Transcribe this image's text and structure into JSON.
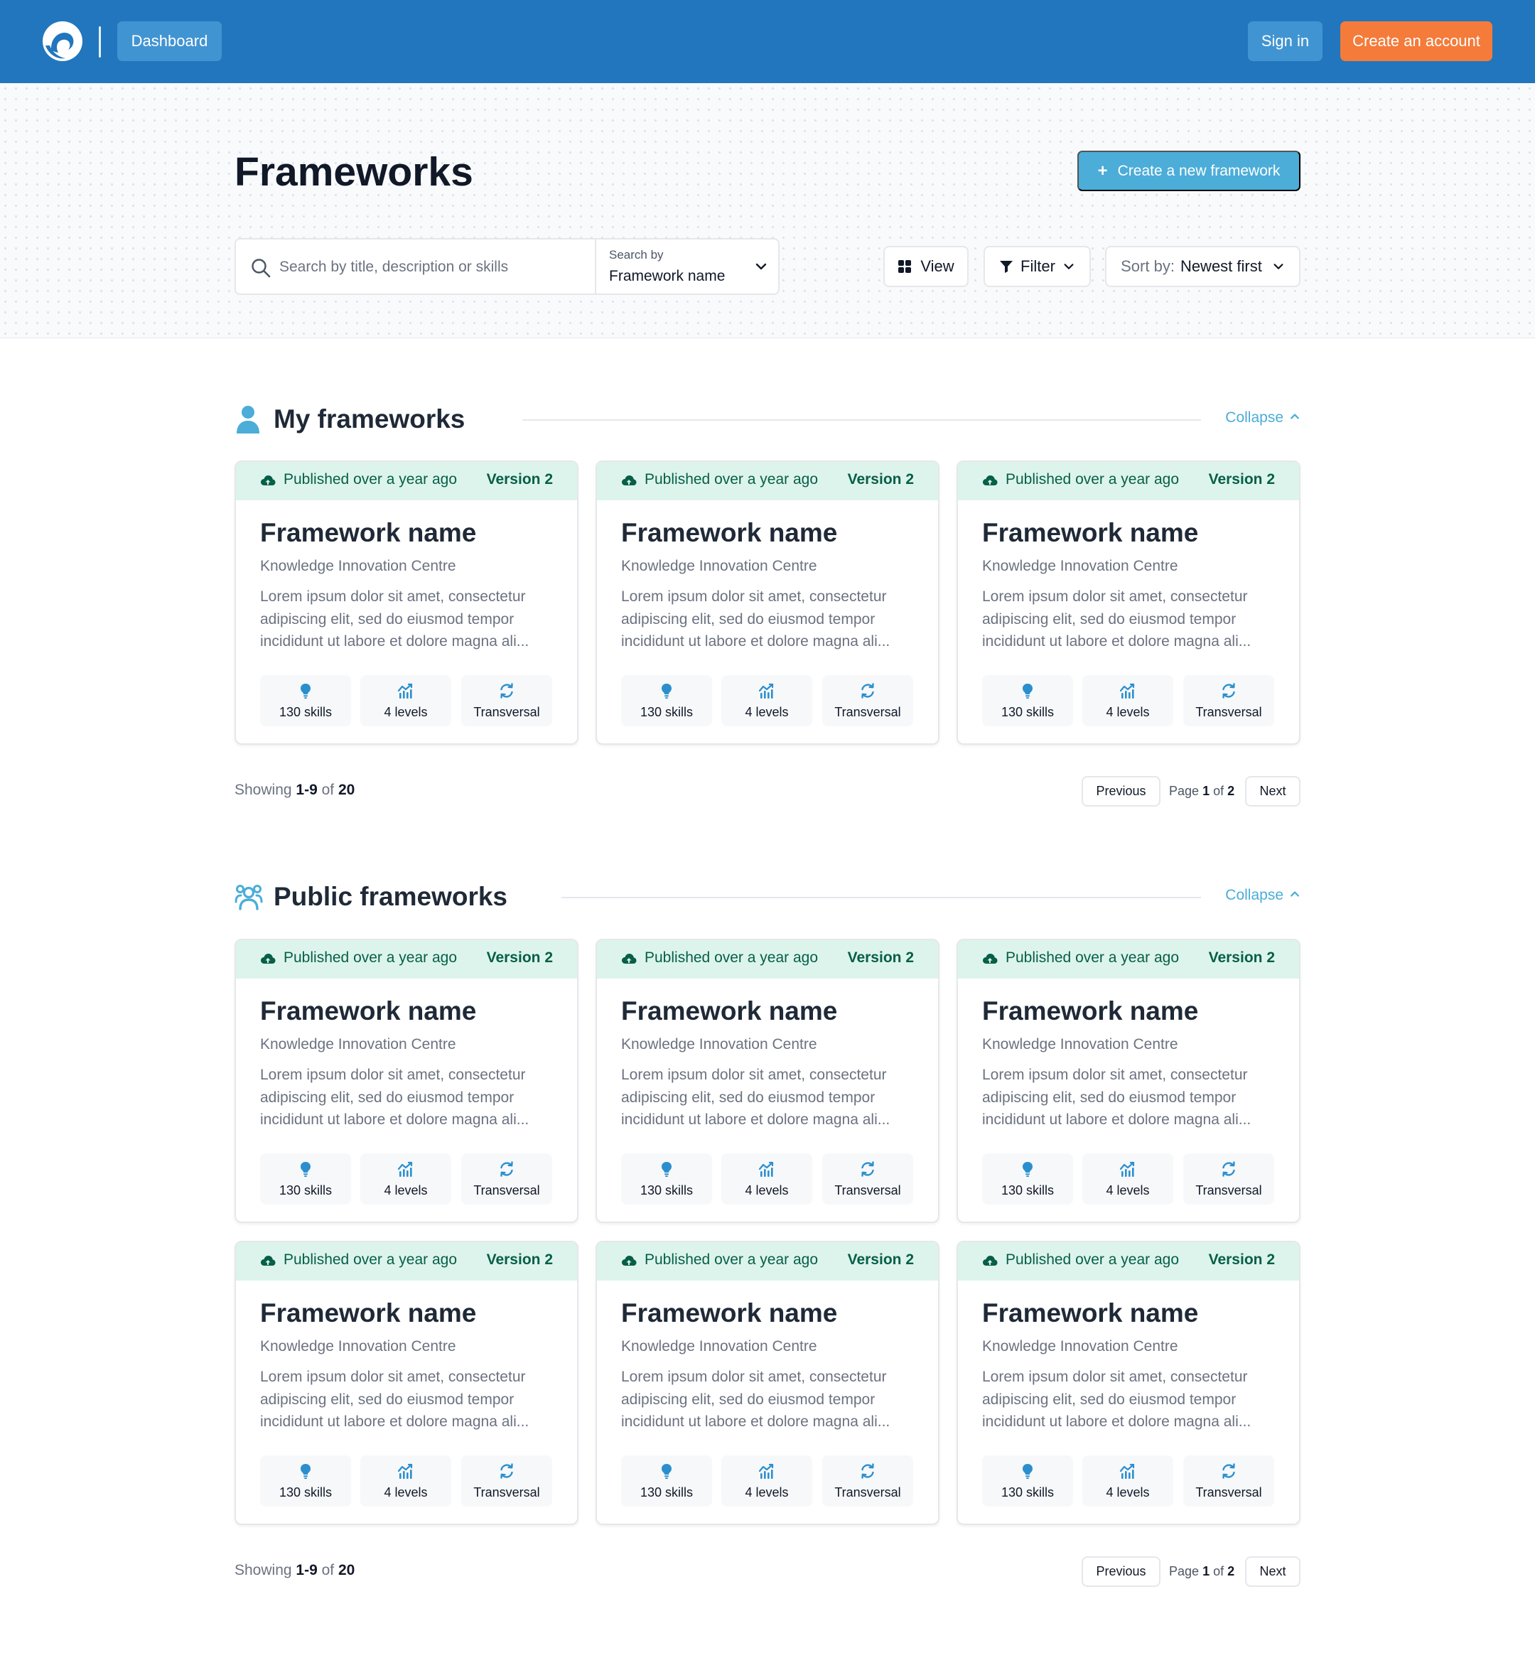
{
  "header": {
    "dashboard_label": "Dashboard",
    "signin_label": "Sign in",
    "create_account_label": "Create an account"
  },
  "hero": {
    "title": "Frameworks",
    "new_framework_label": "Create a new framework",
    "search": {
      "placeholder": "Search by title, description or skills",
      "value": "",
      "search_by_label": "Search by",
      "search_by_value": "Framework name"
    },
    "view_label": "View",
    "filter_label": "Filter",
    "sort_label": "Sort by:",
    "sort_value": "Newest first"
  },
  "sections": [
    {
      "title": "My frameworks",
      "icon": "user-icon",
      "collapse_label": "Collapse",
      "cards": [
        {
          "published": "Published over a year ago",
          "version": "Version 2",
          "title": "Framework name",
          "org": "Knowledge Innovation Centre",
          "description": "Lorem ipsum dolor sit amet, consectetur adipiscing elit, sed do eiusmod tempor incididunt ut labore et dolore magna ali...",
          "skills": "130 skills",
          "levels": "4 levels",
          "type": "Transversal"
        },
        {
          "published": "Published over a year ago",
          "version": "Version 2",
          "title": "Framework name",
          "org": "Knowledge Innovation Centre",
          "description": "Lorem ipsum dolor sit amet, consectetur adipiscing elit, sed do eiusmod tempor incididunt ut labore et dolore magna ali...",
          "skills": "130 skills",
          "levels": "4 levels",
          "type": "Transversal"
        },
        {
          "published": "Published over a year ago",
          "version": "Version 2",
          "title": "Framework name",
          "org": "Knowledge Innovation Centre",
          "description": "Lorem ipsum dolor sit amet, consectetur adipiscing elit, sed do eiusmod tempor incididunt ut labore et dolore magna ali...",
          "skills": "130 skills",
          "levels": "4 levels",
          "type": "Transversal"
        }
      ],
      "showing_prefix": "Showing",
      "showing_range": "1-9",
      "showing_of": "of",
      "showing_total": "20",
      "pager": {
        "previous": "Previous",
        "page_word": "Page",
        "current": "1",
        "of_word": "of",
        "total": "2",
        "next": "Next"
      }
    },
    {
      "title": "Public frameworks",
      "icon": "users-icon",
      "collapse_label": "Collapse",
      "cards": [
        {
          "published": "Published over a year ago",
          "version": "Version 2",
          "title": "Framework name",
          "org": "Knowledge Innovation Centre",
          "description": "Lorem ipsum dolor sit amet, consectetur adipiscing elit, sed do eiusmod tempor incididunt ut labore et dolore magna ali...",
          "skills": "130 skills",
          "levels": "4 levels",
          "type": "Transversal"
        },
        {
          "published": "Published over a year ago",
          "version": "Version 2",
          "title": "Framework name",
          "org": "Knowledge Innovation Centre",
          "description": "Lorem ipsum dolor sit amet, consectetur adipiscing elit, sed do eiusmod tempor incididunt ut labore et dolore magna ali...",
          "skills": "130 skills",
          "levels": "4 levels",
          "type": "Transversal"
        },
        {
          "published": "Published over a year ago",
          "version": "Version 2",
          "title": "Framework name",
          "org": "Knowledge Innovation Centre",
          "description": "Lorem ipsum dolor sit amet, consectetur adipiscing elit, sed do eiusmod tempor incididunt ut labore et dolore magna ali...",
          "skills": "130 skills",
          "levels": "4 levels",
          "type": "Transversal"
        },
        {
          "published": "Published over a year ago",
          "version": "Version 2",
          "title": "Framework name",
          "org": "Knowledge Innovation Centre",
          "description": "Lorem ipsum dolor sit amet, consectetur adipiscing elit, sed do eiusmod tempor incididunt ut labore et dolore magna ali...",
          "skills": "130 skills",
          "levels": "4 levels",
          "type": "Transversal"
        },
        {
          "published": "Published over a year ago",
          "version": "Version 2",
          "title": "Framework name",
          "org": "Knowledge Innovation Centre",
          "description": "Lorem ipsum dolor sit amet, consectetur adipiscing elit, sed do eiusmod tempor incididunt ut labore et dolore magna ali...",
          "skills": "130 skills",
          "levels": "4 levels",
          "type": "Transversal"
        },
        {
          "published": "Published over a year ago",
          "version": "Version 2",
          "title": "Framework name",
          "org": "Knowledge Innovation Centre",
          "description": "Lorem ipsum dolor sit amet, consectetur adipiscing elit, sed do eiusmod tempor incididunt ut labore et dolore magna ali...",
          "skills": "130 skills",
          "levels": "4 levels",
          "type": "Transversal"
        }
      ],
      "showing_prefix": "Showing",
      "showing_range": "1-9",
      "showing_of": "of",
      "showing_total": "20",
      "pager": {
        "previous": "Previous",
        "page_word": "Page",
        "current": "1",
        "of_word": "of",
        "total": "2",
        "next": "Next"
      }
    }
  ],
  "colors": {
    "header_bg": "#2176bd",
    "accent_orange": "#f47b3a",
    "accent_blue": "#4badd8",
    "card_header_bg": "#ddf4ec",
    "card_header_text": "#065f46"
  }
}
